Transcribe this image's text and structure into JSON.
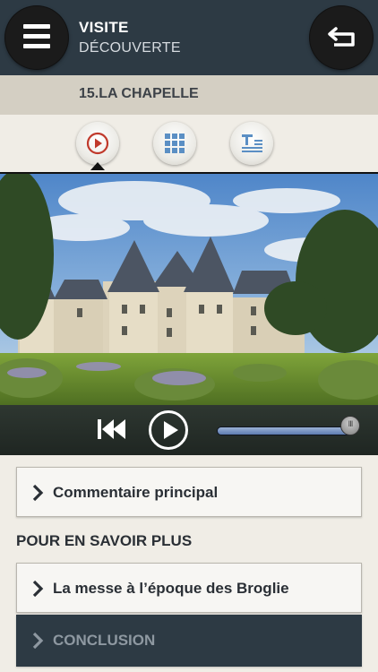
{
  "header": {
    "title": "VISITE",
    "subtitle": "DÉCOUVERTE",
    "menu_icon": "hamburger-menu-icon",
    "back_icon": "return-arrow-icon"
  },
  "section": {
    "title": "15.LA CHAPELLE"
  },
  "tabs": [
    {
      "name": "audio",
      "icon": "play-circle-icon",
      "active": true
    },
    {
      "name": "gallery",
      "icon": "grid-icon",
      "active": false
    },
    {
      "name": "text",
      "icon": "text-lines-icon",
      "active": false
    }
  ],
  "player": {
    "prev_icon": "skip-back-icon",
    "play_icon": "play-icon",
    "progress": 0.98
  },
  "list": {
    "main_item": "Commentaire principal",
    "more_heading": "POUR EN SAVOIR PLUS",
    "items": [
      {
        "label": "La messe à l’époque des Broglie"
      },
      {
        "label": "CONCLUSION"
      }
    ]
  },
  "colors": {
    "header_bg": "#2d3a44",
    "section_bg": "#d4cfc3",
    "page_bg": "#f0ede6",
    "accent_play": "#c0392b"
  }
}
